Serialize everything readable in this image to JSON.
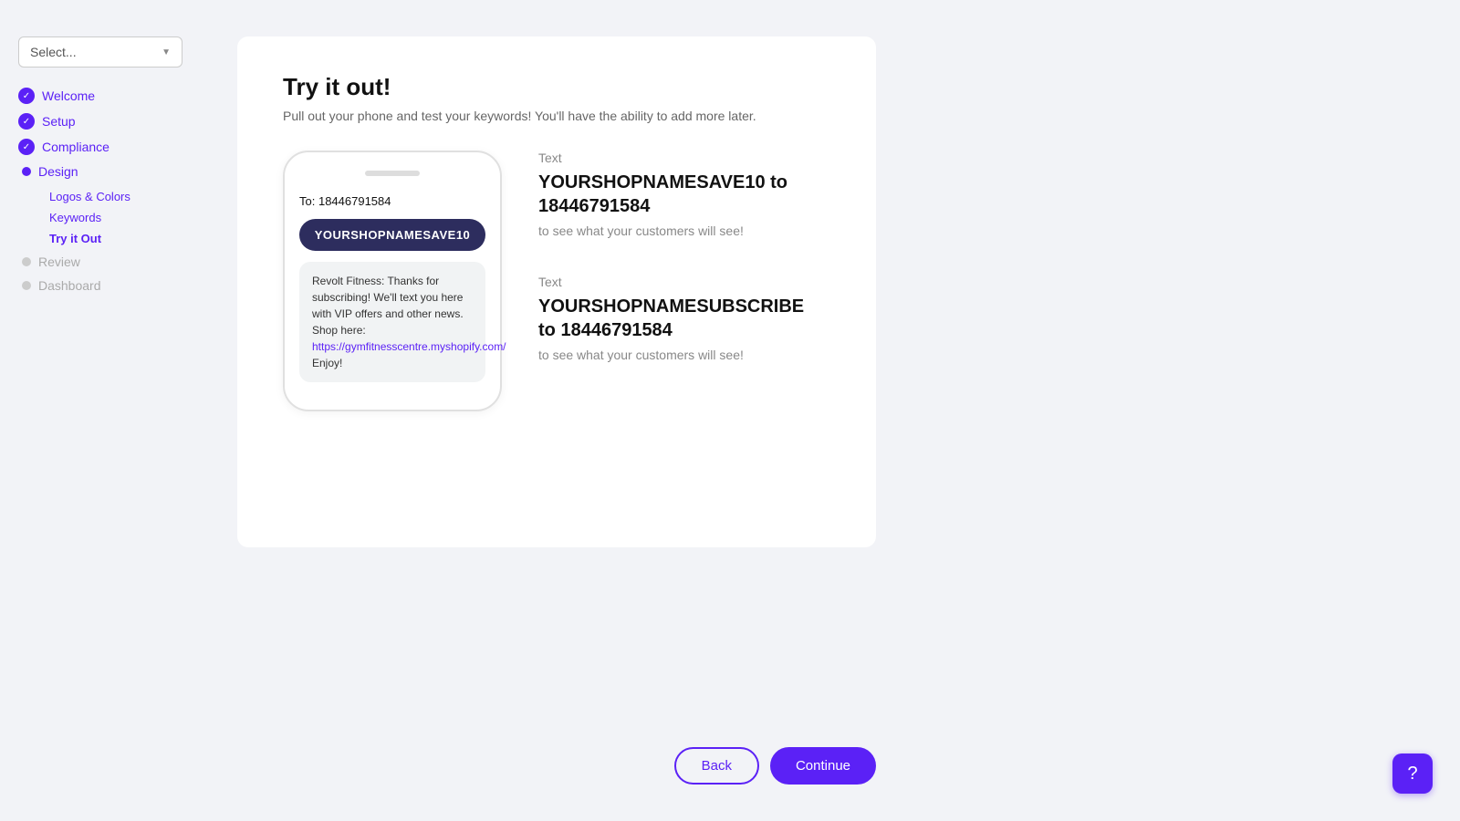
{
  "sidebar": {
    "select_placeholder": "Select...",
    "nav_items": [
      {
        "id": "welcome",
        "label": "Welcome",
        "state": "completed"
      },
      {
        "id": "setup",
        "label": "Setup",
        "state": "completed"
      },
      {
        "id": "compliance",
        "label": "Compliance",
        "state": "completed"
      },
      {
        "id": "design",
        "label": "Design",
        "state": "active",
        "sub_items": [
          {
            "id": "logos-colors",
            "label": "Logos & Colors"
          },
          {
            "id": "keywords",
            "label": "Keywords"
          },
          {
            "id": "try-it-out",
            "label": "Try it Out",
            "active": true
          }
        ]
      },
      {
        "id": "review",
        "label": "Review",
        "state": "inactive"
      },
      {
        "id": "dashboard",
        "label": "Dashboard",
        "state": "inactive"
      }
    ]
  },
  "page": {
    "title": "Try it out!",
    "subtitle": "Pull out your phone and test your keywords! You'll have the ability to add more later."
  },
  "phone": {
    "to_label": "To:",
    "to_number": "18446791584",
    "keyword_bubble": "YOURSHOPNAMESAVE10",
    "sms_text": "Revolt Fitness: Thanks for subscribing! We'll text you here with VIP offers and other news. Shop here: ",
    "sms_link": "https://gymfitnesscentre.myshopify.com/",
    "sms_end": " Enjoy!"
  },
  "instructions": [
    {
      "id": "save10",
      "prefix": "Text",
      "keyword": "YOURSHOPNAMESAVE10",
      "connector": "to",
      "number": "18446791584",
      "suffix": "to see what your customers will see!"
    },
    {
      "id": "subscribe",
      "prefix": "Text",
      "keyword": "YOURSHOPNAMESUBSCRIBE",
      "connector": "to",
      "number": "18446791584",
      "suffix": "to see what your customers will see!"
    }
  ],
  "actions": {
    "back_label": "Back",
    "continue_label": "Continue"
  },
  "help": {
    "icon": "?"
  }
}
